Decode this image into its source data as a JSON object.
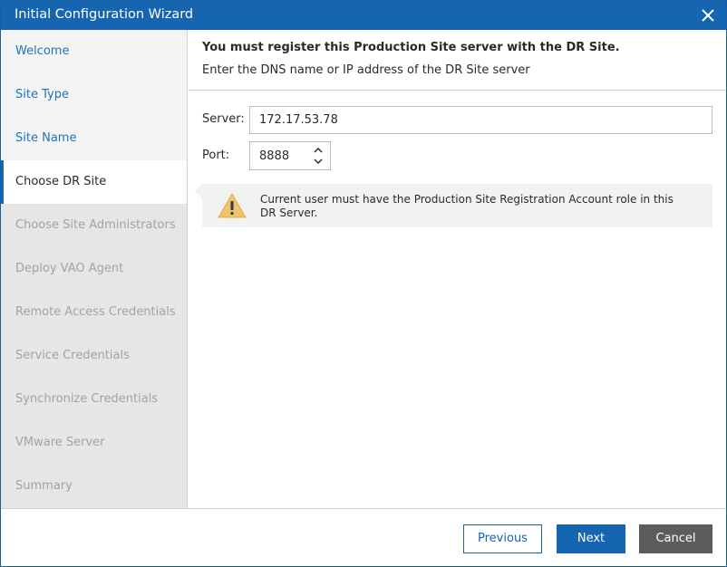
{
  "window": {
    "title": "Initial Configuration Wizard",
    "accent_color": "#1565b0"
  },
  "sidebar": {
    "items": [
      {
        "label": "Welcome",
        "state": "done"
      },
      {
        "label": "Site Type",
        "state": "done"
      },
      {
        "label": "Site Name",
        "state": "done"
      },
      {
        "label": "Choose DR Site",
        "state": "active"
      },
      {
        "label": "Choose Site Administrators",
        "state": "future"
      },
      {
        "label": "Deploy VAO Agent",
        "state": "future"
      },
      {
        "label": "Remote Access Credentials",
        "state": "future"
      },
      {
        "label": "Service Credentials",
        "state": "future"
      },
      {
        "label": "Synchronize Credentials",
        "state": "future"
      },
      {
        "label": "VMware Server",
        "state": "future"
      },
      {
        "label": "Summary",
        "state": "future"
      }
    ]
  },
  "main": {
    "heading": "You must register this Production Site server with the DR Site.",
    "subheading": "Enter the DNS name or IP address of the DR Site server",
    "server": {
      "label": "Server:",
      "value": "172.17.53.78"
    },
    "port": {
      "label": "Port:",
      "value": "8888"
    },
    "warning": {
      "icon": "warning-triangle-icon",
      "text": "Current user must have the Production Site Registration Account role in this DR Server."
    }
  },
  "footer": {
    "previous_label": "Previous",
    "next_label": "Next",
    "cancel_label": "Cancel"
  }
}
